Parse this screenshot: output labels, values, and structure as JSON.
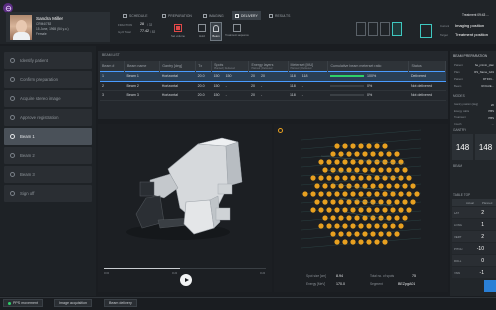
{
  "patient": {
    "name": "Sandra Miller",
    "id": "CRM4/783",
    "dob": "15 June, 1965 (54 y.o.)",
    "sex": "Female"
  },
  "fraction": {
    "label1": "FRACTION",
    "value1": "28",
    "value1b": "/ 33",
    "label2": "Gy/d Total",
    "value2": "77.42",
    "value2b": "/ 83"
  },
  "tabs": [
    {
      "label": "SCHEDULE"
    },
    {
      "label": "PREPARATION"
    },
    {
      "label": "IMAGING"
    },
    {
      "label": "DELIVERY"
    },
    {
      "label": "RESULTS"
    }
  ],
  "toolbar": {
    "btn1": "Set volume",
    "btn2": "Hold",
    "btn3": "Beam",
    "btn4": "Treatment sequence"
  },
  "right_header": {
    "time": "Treatment 09:43 ...",
    "label_a": "Current",
    "value_a": "Imaging position",
    "label_b": "Target",
    "value_b": "Treatment position",
    "icon_labels": [
      "Couch",
      "Imaging",
      "Treat",
      "Positioned",
      "Reposition",
      "Aborted"
    ]
  },
  "workflow": [
    {
      "label": "Identify patient",
      "active": false
    },
    {
      "label": "Confirm preparation",
      "active": false
    },
    {
      "label": "Acquire stereo image",
      "active": false
    },
    {
      "label": "Approve registration",
      "active": false
    },
    {
      "label": "Beam 1",
      "active": true
    },
    {
      "label": "Beam 2",
      "active": false
    },
    {
      "label": "Beam 3",
      "active": false
    },
    {
      "label": "Sign off",
      "active": false
    }
  ],
  "beam_list": {
    "title": "BEAM LIST",
    "columns": [
      "Beam #",
      "Beam name",
      "Gantry [deg]",
      "Tx",
      "Spots",
      "Energy layers",
      "Meterset [MU]",
      "Cumulative beam meterset ratio",
      "Status"
    ],
    "sub_columns": [
      "",
      "",
      "",
      "",
      "Planned | Delivered",
      "Planned | Delivered",
      "Planned | Delivered",
      "",
      ""
    ],
    "rows": [
      {
        "num": "1",
        "name": "Beam 1",
        "gantry": "Horizontal",
        "tx": "20.0",
        "spots": "150",
        "spots_d": "150",
        "energy": "20",
        "energy_d": "20",
        "mu": "118",
        "mu_d": "118",
        "ratio": 1.0,
        "ratio_txt": "100%",
        "status": "Delivered"
      },
      {
        "num": "2",
        "name": "Beam 2",
        "gantry": "Horizontal",
        "tx": "20.0",
        "spots": "150",
        "spots_d": "-",
        "energy": "20",
        "energy_d": "-",
        "mu": "118",
        "mu_d": "-",
        "ratio": 0,
        "ratio_txt": "0%",
        "status": "Not delivered"
      },
      {
        "num": "3",
        "name": "Beam 3",
        "gantry": "Horizontal",
        "tx": "20.0",
        "spots": "150",
        "spots_d": "-",
        "energy": "20",
        "energy_d": "-",
        "mu": "118",
        "mu_d": "-",
        "ratio": 0,
        "ratio_txt": "0%",
        "status": "Not delivered"
      }
    ]
  },
  "player": {
    "start": "0:00",
    "mid": "0:24",
    "end": "0:24"
  },
  "spot_info": {
    "l1": "Spot size [cm]",
    "v1": "8.94",
    "l2": "Energy [MeV]",
    "v2": "170.0",
    "l3": "Total no. of spots",
    "v3": "75",
    "l4": "Segment",
    "v4": "BEZpgA01"
  },
  "right_panel": {
    "title": "BEAM PREPARATION",
    "rows": [
      {
        "k": "Patient",
        "v": "Sa_primin_plan"
      },
      {
        "k": "Plan",
        "v": "RS_Name_G01"
      },
      {
        "k": "Patient",
        "v": "RTION..."
      },
      {
        "k": "Beam",
        "v": "ROGUE..."
      }
    ],
    "modes_title": "MODES",
    "modes": [
      {
        "k": "Gantry position [deg]",
        "v": "20"
      },
      {
        "k": "Energy cable",
        "v": "PBS"
      },
      {
        "k": "Treatment",
        "v": "PBS"
      },
      {
        "k": "Couch",
        "v": "..."
      }
    ],
    "gantry_title": "GANTRY",
    "gantry_a": "148",
    "gantry_b": "148",
    "beam_title": "BEAM",
    "table_title": "TABLE TOP",
    "table_head": [
      "",
      "Actual",
      "Planned"
    ],
    "table_rows": [
      {
        "k": "LAT",
        "a": "2",
        "p": ""
      },
      {
        "k": "LONG",
        "a": "1",
        "p": ""
      },
      {
        "k": "VERT",
        "a": "2",
        "p": ""
      },
      {
        "k": "PITCH",
        "a": "-10",
        "p": ""
      },
      {
        "k": "ROLL",
        "a": "0",
        "p": ""
      },
      {
        "k": "YAW",
        "a": "-1",
        "p": ""
      }
    ]
  },
  "bottom": {
    "btn1": "PPS movement",
    "btn2": "Image acquisition",
    "btn3": "Beam delivery"
  },
  "colors": {
    "accent": "#4a9cff",
    "spot": "#e8a020",
    "progress": "#2fd06a",
    "teal": "#3ec8c0"
  }
}
